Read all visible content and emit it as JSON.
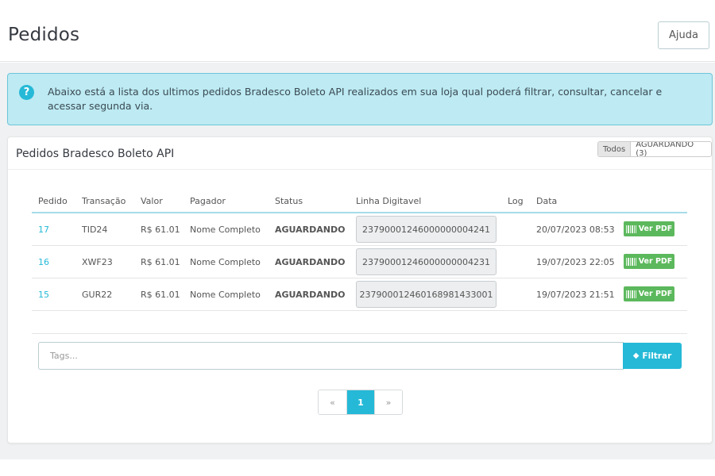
{
  "header": {
    "title": "Pedidos",
    "help_label": "Ajuda"
  },
  "alert": {
    "icon": "question-circle-icon",
    "text": "Abaixo está a lista dos ultimos pedidos Bradesco Boleto API realizados em sua loja qual poderá filtrar, consultar, cancelar e acessar segunda via."
  },
  "panel": {
    "title": "Pedidos Bradesco Boleto API",
    "filters": [
      "Todos",
      "AGUARDANDO (3)"
    ]
  },
  "table": {
    "headers": [
      "Pedido",
      "Transação",
      "Valor",
      "Pagador",
      "Status",
      "Linha Digitavel",
      "Log",
      "Data"
    ],
    "rows": [
      {
        "pedido": "17",
        "transacao": "TID24",
        "valor": "R$ 61.01",
        "pagador": "Nome Completo",
        "status": "AGUARDANDO",
        "linha": "23790001246000000004241",
        "log": "",
        "data": "20/07/2023 08:53",
        "action": "Ver PDF"
      },
      {
        "pedido": "16",
        "transacao": "XWF23",
        "valor": "R$ 61.01",
        "pagador": "Nome Completo",
        "status": "AGUARDANDO",
        "linha": "23790001246000000004231",
        "log": "",
        "data": "19/07/2023 22:05",
        "action": "Ver PDF"
      },
      {
        "pedido": "15",
        "transacao": "GUR22",
        "valor": "R$ 61.01",
        "pagador": "Nome Completo",
        "status": "AGUARDANDO",
        "linha": "23790001246016898143300​1",
        "log": "",
        "data": "19/07/2023 21:51",
        "action": "Ver PDF"
      }
    ]
  },
  "search": {
    "placeholder": "Tags...",
    "button_label": "Filtrar"
  },
  "pagination": {
    "prev": "«",
    "current": "1",
    "next": "»"
  },
  "colors": {
    "accent": "#25b9d7",
    "success": "#5cb85c",
    "alert_bg": "#bdeaf3"
  }
}
